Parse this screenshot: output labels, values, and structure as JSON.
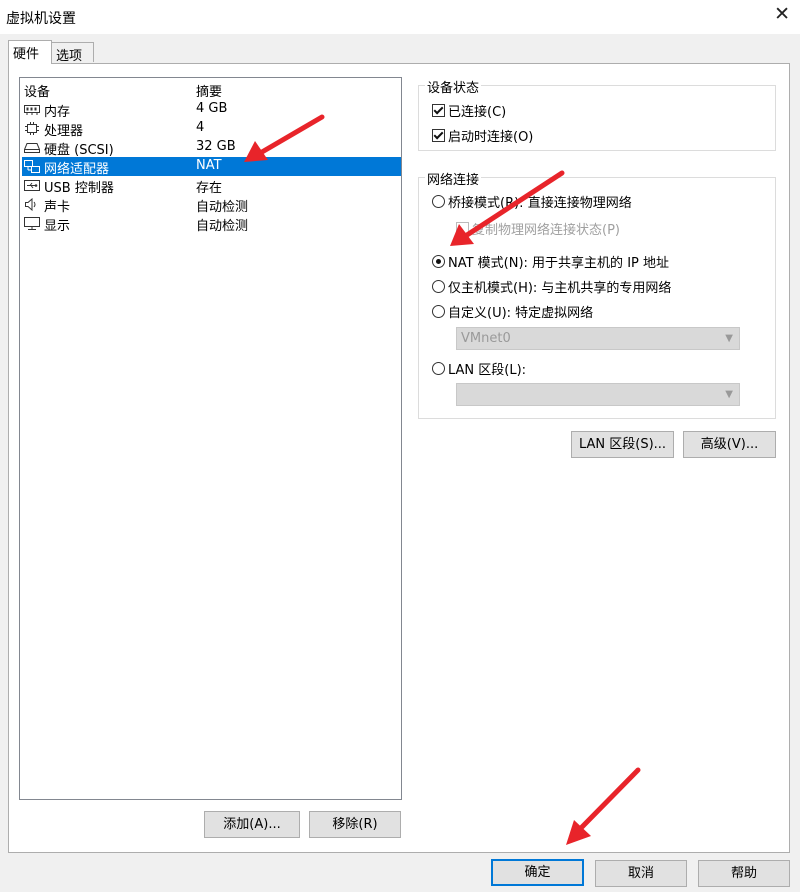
{
  "window": {
    "title": "虚拟机设置",
    "close_glyph": "✕"
  },
  "tabs": [
    {
      "label": "硬件"
    },
    {
      "label": "选项"
    }
  ],
  "device_table": {
    "columns": {
      "device": "设备",
      "summary": "摘要"
    },
    "rows": [
      {
        "name": "内存",
        "summary": "4 GB",
        "icon": "memory-icon"
      },
      {
        "name": "处理器",
        "summary": "4",
        "icon": "processor-icon"
      },
      {
        "name": "硬盘 (SCSI)",
        "summary": "32 GB",
        "icon": "hard-disk-icon"
      },
      {
        "name": "网络适配器",
        "summary": "NAT",
        "icon": "network-adapter-icon",
        "selected": true
      },
      {
        "name": "USB 控制器",
        "summary": "存在",
        "icon": "usb-controller-icon"
      },
      {
        "name": "声卡",
        "summary": "自动检测",
        "icon": "sound-card-icon"
      },
      {
        "name": "显示",
        "summary": "自动检测",
        "icon": "display-icon"
      }
    ]
  },
  "device_buttons": {
    "add": "添加(A)...",
    "remove": "移除(R)"
  },
  "device_status": {
    "title": "设备状态",
    "connected": {
      "label": "已连接(C)",
      "checked": true
    },
    "connect_at_power_on": {
      "label": "启动时连接(O)",
      "checked": true
    }
  },
  "network_connection": {
    "title": "网络连接",
    "bridged": {
      "label": "桥接模式(R): 直接连接物理网络",
      "checked": false
    },
    "replicate": {
      "label": "复制物理网络连接状态(P)",
      "checked": false,
      "enabled": false
    },
    "nat": {
      "label": "NAT 模式(N): 用于共享主机的 IP 地址",
      "checked": true
    },
    "host_only": {
      "label": "仅主机模式(H): 与主机共享的专用网络",
      "checked": false
    },
    "custom": {
      "label": "自定义(U): 特定虚拟网络",
      "checked": false
    },
    "custom_select": {
      "value": "VMnet0"
    },
    "lan_segment": {
      "label": "LAN 区段(L):",
      "checked": false
    },
    "lan_select": {
      "value": ""
    }
  },
  "network_buttons": {
    "lan_segments": "LAN 区段(S)...",
    "advanced": "高级(V)..."
  },
  "footer_buttons": {
    "ok": "确定",
    "cancel": "取消",
    "help": "帮助"
  },
  "colors": {
    "selection": "#0078d7",
    "annotation_arrow": "#e8242a"
  }
}
